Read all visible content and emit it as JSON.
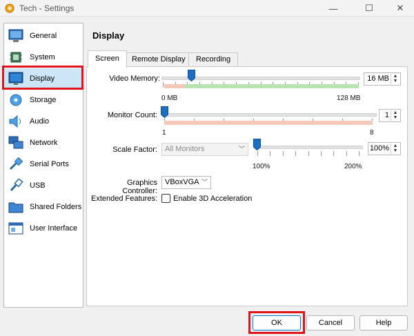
{
  "window": {
    "title": "Tech - Settings",
    "minimize_glyph": "—",
    "maximize_glyph": "☐",
    "close_glyph": "✕",
    "icon": "virtualbox-icon"
  },
  "sidebar": {
    "items": [
      {
        "label": "General",
        "icon": "general-icon"
      },
      {
        "label": "System",
        "icon": "system-icon"
      },
      {
        "label": "Display",
        "icon": "display-icon"
      },
      {
        "label": "Storage",
        "icon": "storage-icon"
      },
      {
        "label": "Audio",
        "icon": "audio-icon"
      },
      {
        "label": "Network",
        "icon": "network-icon"
      },
      {
        "label": "Serial Ports",
        "icon": "serial-ports-icon"
      },
      {
        "label": "USB",
        "icon": "usb-icon"
      },
      {
        "label": "Shared Folders",
        "icon": "shared-folders-icon"
      },
      {
        "label": "User Interface",
        "icon": "user-interface-icon"
      }
    ],
    "selected": "Display"
  },
  "main": {
    "title": "Display",
    "tabs": [
      {
        "label": "Screen",
        "active": true
      },
      {
        "label": "Remote Display",
        "active": false
      },
      {
        "label": "Recording",
        "active": false
      }
    ],
    "video_memory": {
      "label": "Video Memory:",
      "value": "16 MB",
      "min_label": "0 MB",
      "max_label": "128 MB",
      "fraction": 0.124
    },
    "monitor_count": {
      "label": "Monitor Count:",
      "value": "1",
      "min_label": "1",
      "max_label": "8",
      "fraction": 0.0
    },
    "scale_factor": {
      "label": "Scale Factor:",
      "monitor_select": "All Monitors",
      "value": "100%",
      "min_label": "100%",
      "max_label": "200%",
      "fraction": 0.0
    },
    "graphics_controller": {
      "label": "Graphics Controller:",
      "value": "VBoxVGA"
    },
    "extended_features": {
      "label": "Extended Features:",
      "checkbox_label": "Enable 3D Acceleration",
      "checked": false
    }
  },
  "buttons": {
    "ok": "OK",
    "cancel": "Cancel",
    "help": "Help"
  },
  "colors": {
    "selection_highlight": "#e0141a",
    "selected_item_bg": "#cce6f7",
    "slider_thumb": "#1a6fc4",
    "zone_green": "#b7e4b0",
    "zone_red": "#f5c8b7"
  }
}
